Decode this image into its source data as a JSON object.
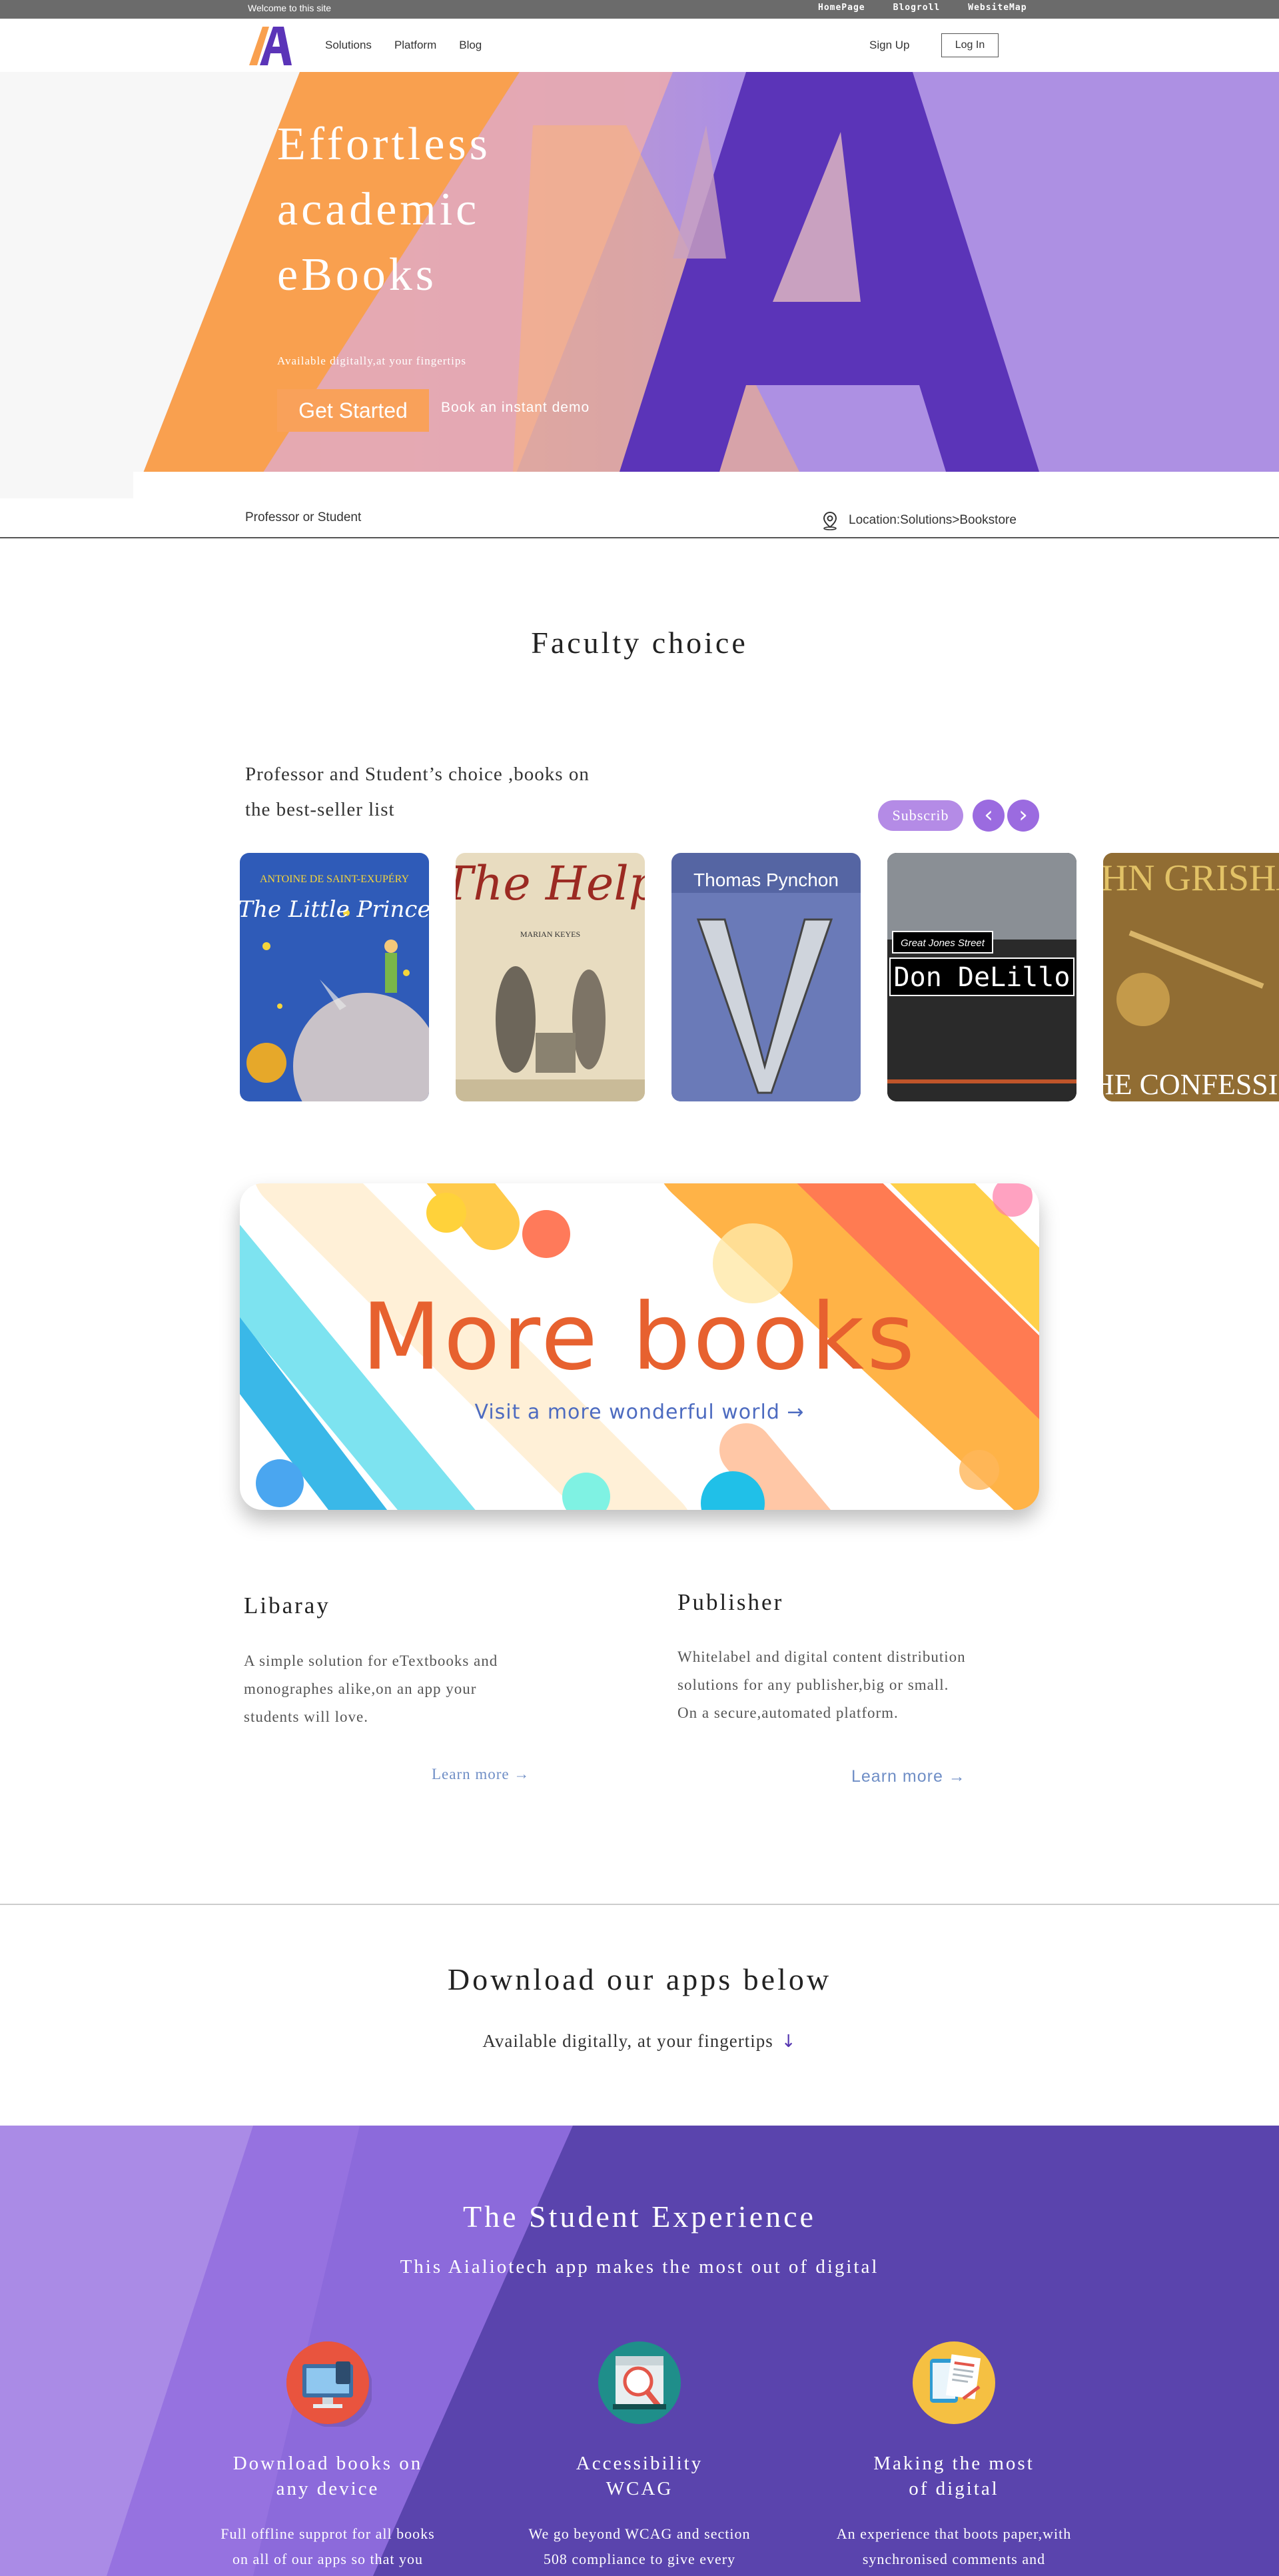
{
  "topbar": {
    "welcome": "Welcome to this site",
    "links": [
      "HomePage",
      "Blogroll",
      "WebsiteMap"
    ]
  },
  "nav": {
    "menu": [
      "Solutions",
      "Platform",
      "Blog"
    ],
    "signup": "Sign Up",
    "login": "Log In"
  },
  "hero": {
    "title_lines": [
      "Effortless",
      "academic",
      "eBooks"
    ],
    "subtitle": "Available digitally,at your fingertips",
    "cta": "Get Started",
    "demo": "Book an instant demo"
  },
  "strip": {
    "role": "Professor or Student",
    "location": "Location:Solutions>Bookstore"
  },
  "faculty": {
    "title": "Faculty choice",
    "desc_lines": [
      "Professor and Student’s choice ,books on",
      "the best-seller list"
    ],
    "subscribe": "Subscrib",
    "books": [
      {
        "top": "ANTOINE DE SAINT-EXUPÉRY",
        "title": "The Little Prince"
      },
      {
        "top": "The Help",
        "title": "MARIAN KEYES"
      },
      {
        "top": "Thomas Pynchon",
        "title": "V."
      },
      {
        "top": "Great Jones Street",
        "title": "Don DeLillo"
      },
      {
        "top": "JOHN GRISHAM",
        "title": "THE CONFESSION"
      }
    ]
  },
  "banner": {
    "title": "More books",
    "subtitle": "Visit a more wonderful world →"
  },
  "library": {
    "title": "Libaray",
    "lines": [
      "A simple solution for eTextbooks and",
      "monographes alike,on an app your",
      "students will love."
    ],
    "learn": "Learn more →"
  },
  "publisher": {
    "title": "Publisher",
    "lines": [
      "Whitelabel and digital content distribution",
      "solutions for any publisher,big or small.",
      "On a secure,automated platform."
    ],
    "learn": "Learn more →"
  },
  "download": {
    "title": "Download our apps below",
    "subtitle": "Available digitally, at your fingertips",
    "arrow": "↓"
  },
  "student": {
    "title": "The Student Experience",
    "subtitle": "This Aialiotech app makes the most out of digital",
    "features": [
      {
        "icon": "computer-icon",
        "title_lines": [
          "Download books on",
          "any device"
        ],
        "text_lines": [
          "Full offline supprot for all books",
          "on all of our apps so that you"
        ]
      },
      {
        "icon": "magnifier-book-icon",
        "title_lines": [
          "Accessibility",
          "WCAG"
        ],
        "text_lines": [
          "We go beyond WCAG and section",
          "508 compliance to give every"
        ]
      },
      {
        "icon": "document-icon",
        "title_lines": [
          "Making the most",
          "of digital"
        ],
        "text_lines": [
          "An experience that boots paper,with",
          "synchronised comments and"
        ]
      }
    ]
  },
  "colors": {
    "purple": "#5b34b8",
    "light_purple": "#ad90e3",
    "orange": "#f9a04f",
    "topbar": "#6b6b6b"
  }
}
